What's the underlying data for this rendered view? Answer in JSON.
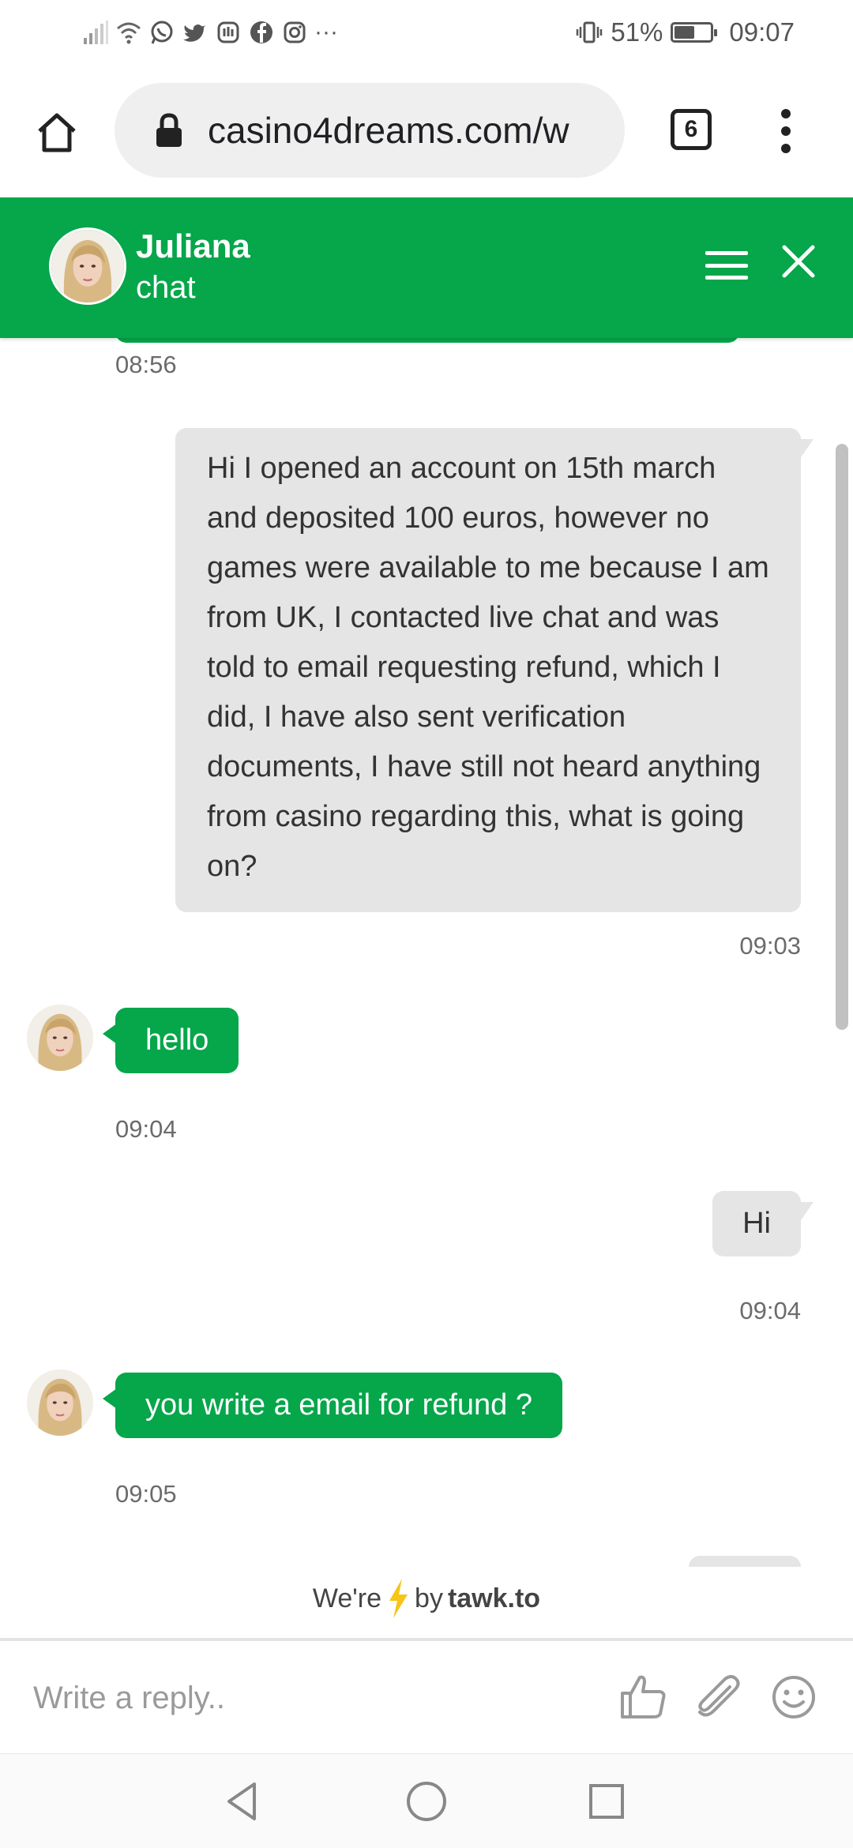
{
  "status_bar": {
    "battery_percent": "51%",
    "battery_level": 0.51,
    "time": "09:07",
    "more": "···"
  },
  "browser": {
    "url": "casino4dreams.com/w",
    "tab_count": "6"
  },
  "chat_header": {
    "agent_name": "Juliana",
    "subtitle": "chat"
  },
  "messages": [
    {
      "sender": "agent",
      "time": "08:56"
    },
    {
      "sender": "visitor",
      "text": "Hi I opened an account on 15th march and deposited 100 euros, however no games were available to me because I am from UK, I contacted live chat and was told to email requesting refund, which I did, I have also sent verification documents, I have still not heard anything from casino regarding this, what is going on?",
      "time": "09:03"
    },
    {
      "sender": "agent",
      "text": "hello",
      "time": "09:04"
    },
    {
      "sender": "visitor",
      "text": "Hi",
      "time": "09:04"
    },
    {
      "sender": "agent",
      "text": "you write a email for refund ?",
      "time": "09:05"
    }
  ],
  "footer": {
    "powered_prefix": "We're",
    "powered_by": "by",
    "brand": "tawk.to"
  },
  "reply": {
    "placeholder": "Write a reply.."
  },
  "colors": {
    "accent": "#06a64a",
    "visitor_bubble": "#e5e5e5",
    "bolt": "#f5c518"
  }
}
